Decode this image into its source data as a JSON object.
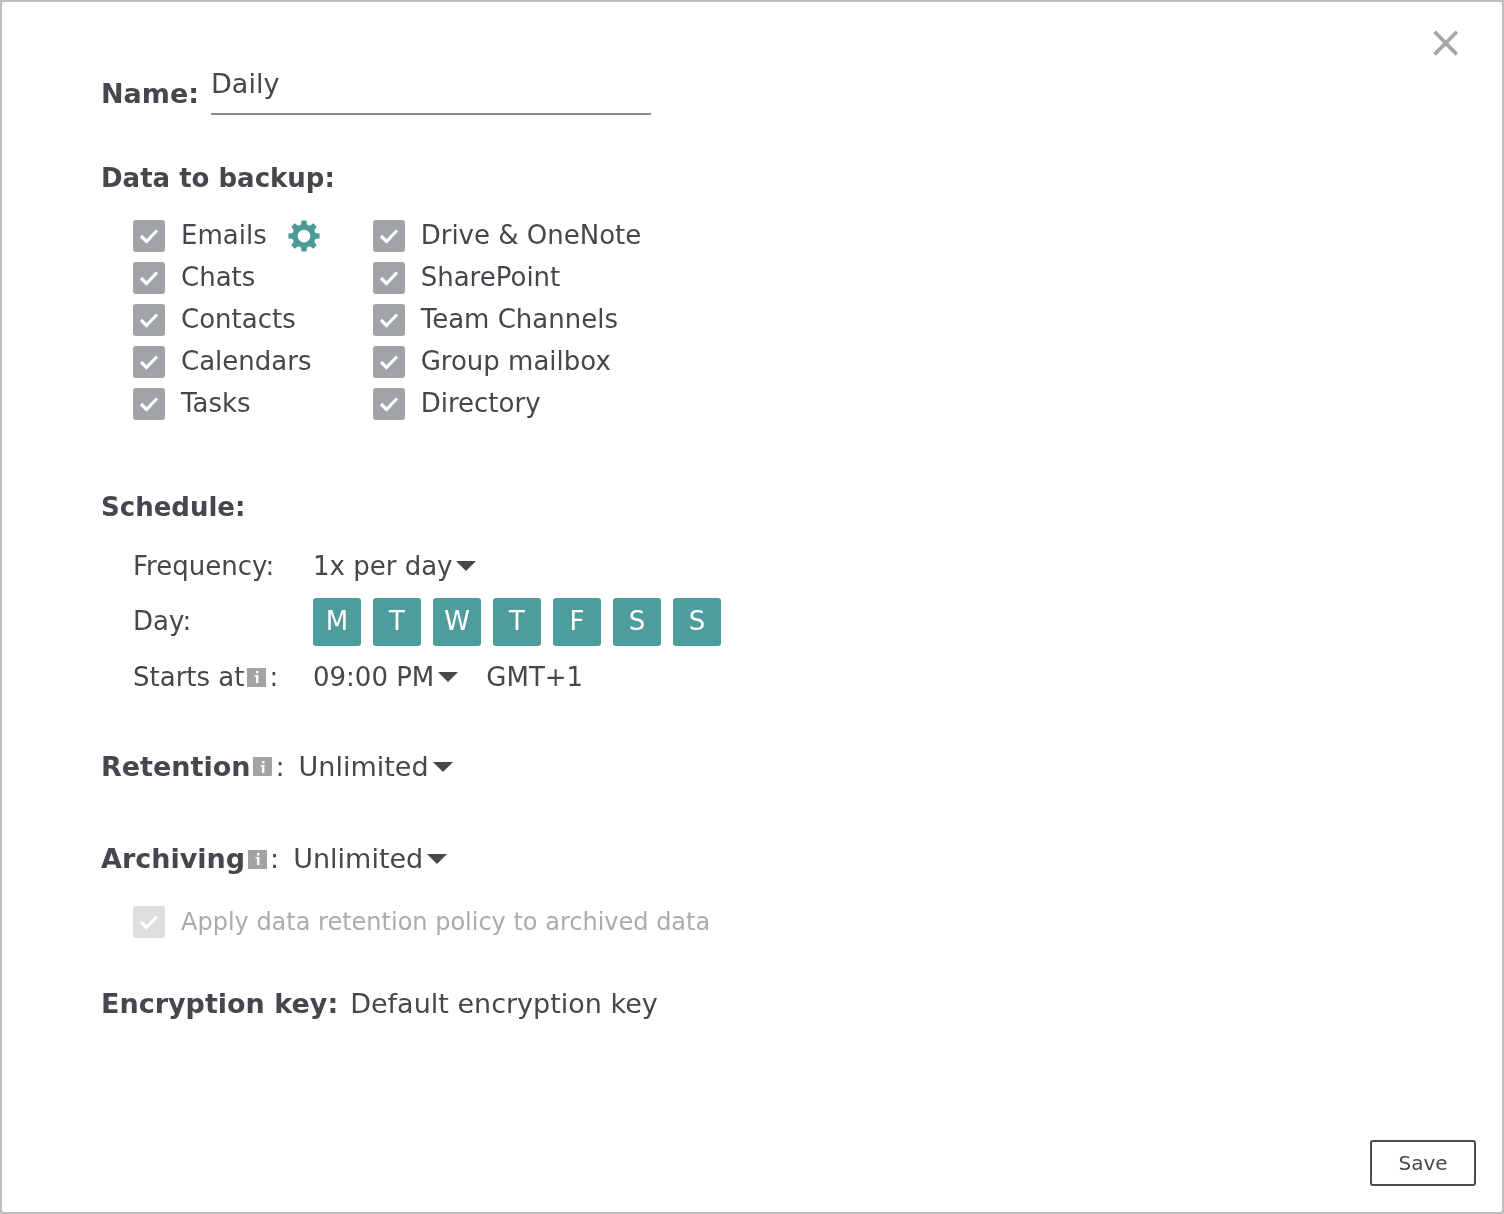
{
  "close": "×",
  "name": {
    "label": "Name:",
    "value": "Daily"
  },
  "data_to_backup": {
    "label": "Data to backup:",
    "columns": [
      [
        {
          "label": "Emails",
          "checked": true,
          "settings": true
        },
        {
          "label": "Chats",
          "checked": true
        },
        {
          "label": "Contacts",
          "checked": true
        },
        {
          "label": "Calendars",
          "checked": true
        },
        {
          "label": "Tasks",
          "checked": true
        }
      ],
      [
        {
          "label": "Drive & OneNote",
          "checked": true
        },
        {
          "label": "SharePoint",
          "checked": true
        },
        {
          "label": "Team Channels",
          "checked": true
        },
        {
          "label": "Group mailbox",
          "checked": true
        },
        {
          "label": "Directory",
          "checked": true
        }
      ]
    ]
  },
  "schedule": {
    "label": "Schedule:",
    "frequency_label": "Frequency:",
    "frequency": "1x per day",
    "day_label": "Day:",
    "days": [
      {
        "label": "M",
        "selected": true
      },
      {
        "label": "T",
        "selected": true
      },
      {
        "label": "W",
        "selected": true
      },
      {
        "label": "T",
        "selected": true
      },
      {
        "label": "F",
        "selected": true
      },
      {
        "label": "S",
        "selected": true
      },
      {
        "label": "S",
        "selected": true
      }
    ],
    "starts_label": "Starts at",
    "starts_colon": ":",
    "starts_at": "09:00 PM",
    "timezone": "GMT+1"
  },
  "retention": {
    "label": "Retention",
    "colon": ":",
    "value": "Unlimited"
  },
  "archiving": {
    "label": "Archiving",
    "colon": ":",
    "value": "Unlimited",
    "apply_policy": {
      "label": "Apply data retention policy to archived data",
      "checked": true,
      "disabled": true
    }
  },
  "encryption": {
    "label": "Encryption key:",
    "value": "Default encryption key"
  },
  "save": "Save"
}
